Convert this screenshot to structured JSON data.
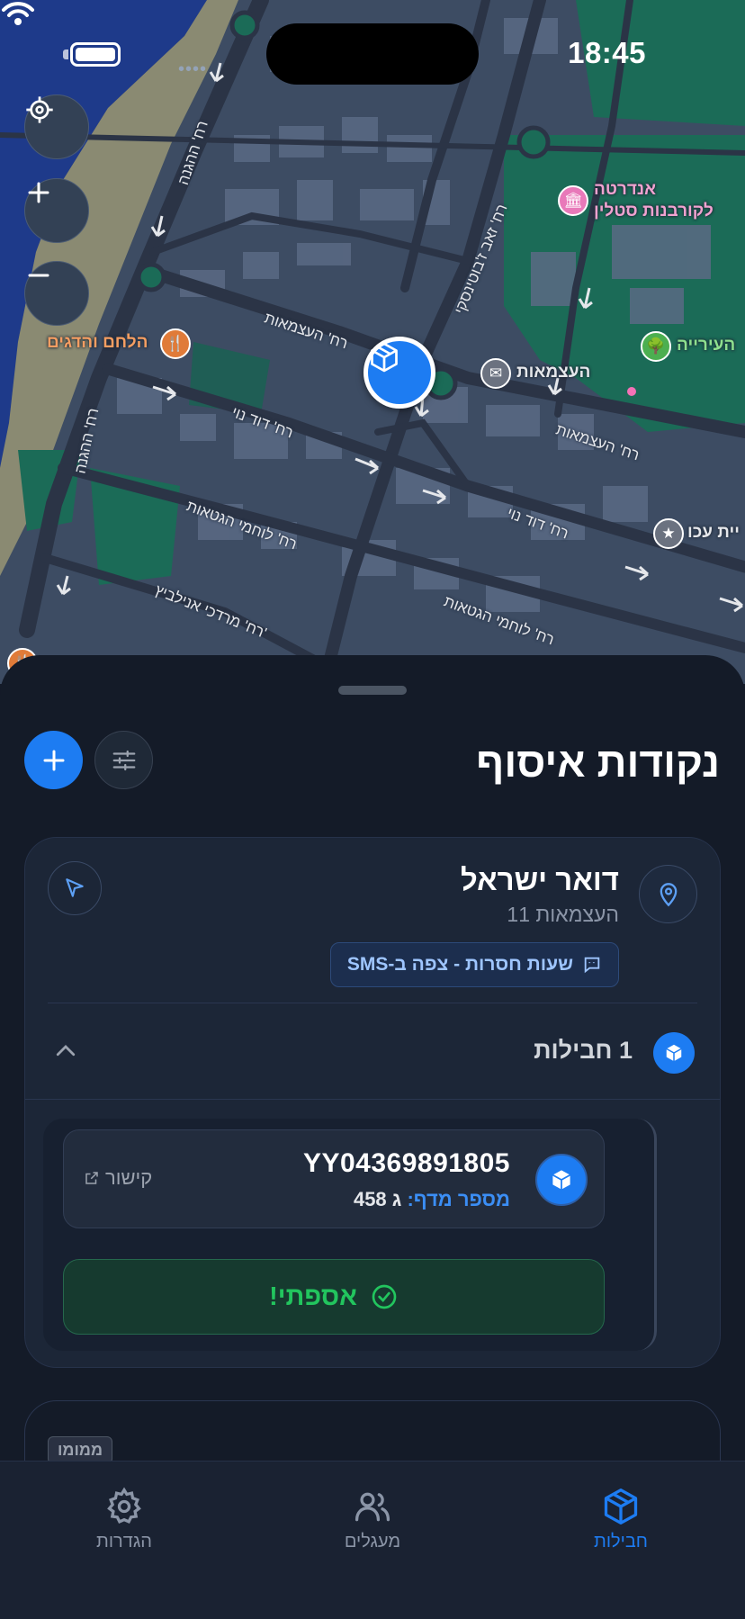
{
  "status_bar": {
    "time": "18:45"
  },
  "map": {
    "streets": [
      "רח' ההגנה",
      "רח' ההגנה",
      "רח' העצמאות",
      "רח' העצמאות",
      "רח' דוד נוי",
      "רח' דוד נוי",
      "רח' לוחמי הגטאות",
      "רח' לוחמי הגטאות",
      "רח' מרדכי אנילביץ'",
      "רח' זאב ז'בוטינסקי"
    ],
    "pois": {
      "restaurant": "הלחם והדגים",
      "post": "העצמאות",
      "monument_line1": "אנדרטה",
      "monument_line2": "לקורבנות סטלין",
      "park": "העירייה",
      "police": "יית עכו"
    }
  },
  "sheet": {
    "title": "נקודות איסוף",
    "pickup_point": {
      "name": "דואר ישראל",
      "address": "העצמאות 11",
      "sms_chip": "שעות חסרות - צפה ב-SMS",
      "package_count": "1 חבילות",
      "package": {
        "tracking": "YY04369891805",
        "shelf_label": "מספר מדף:",
        "shelf_value": "ג 458",
        "link_label": "קישור",
        "collected_label": "אספתי!"
      }
    },
    "next_card_tag": "ממומו"
  },
  "tabs": [
    {
      "label": "חבילות",
      "active": true
    },
    {
      "label": "מעגלים",
      "active": false
    },
    {
      "label": "הגדרות",
      "active": false
    }
  ]
}
